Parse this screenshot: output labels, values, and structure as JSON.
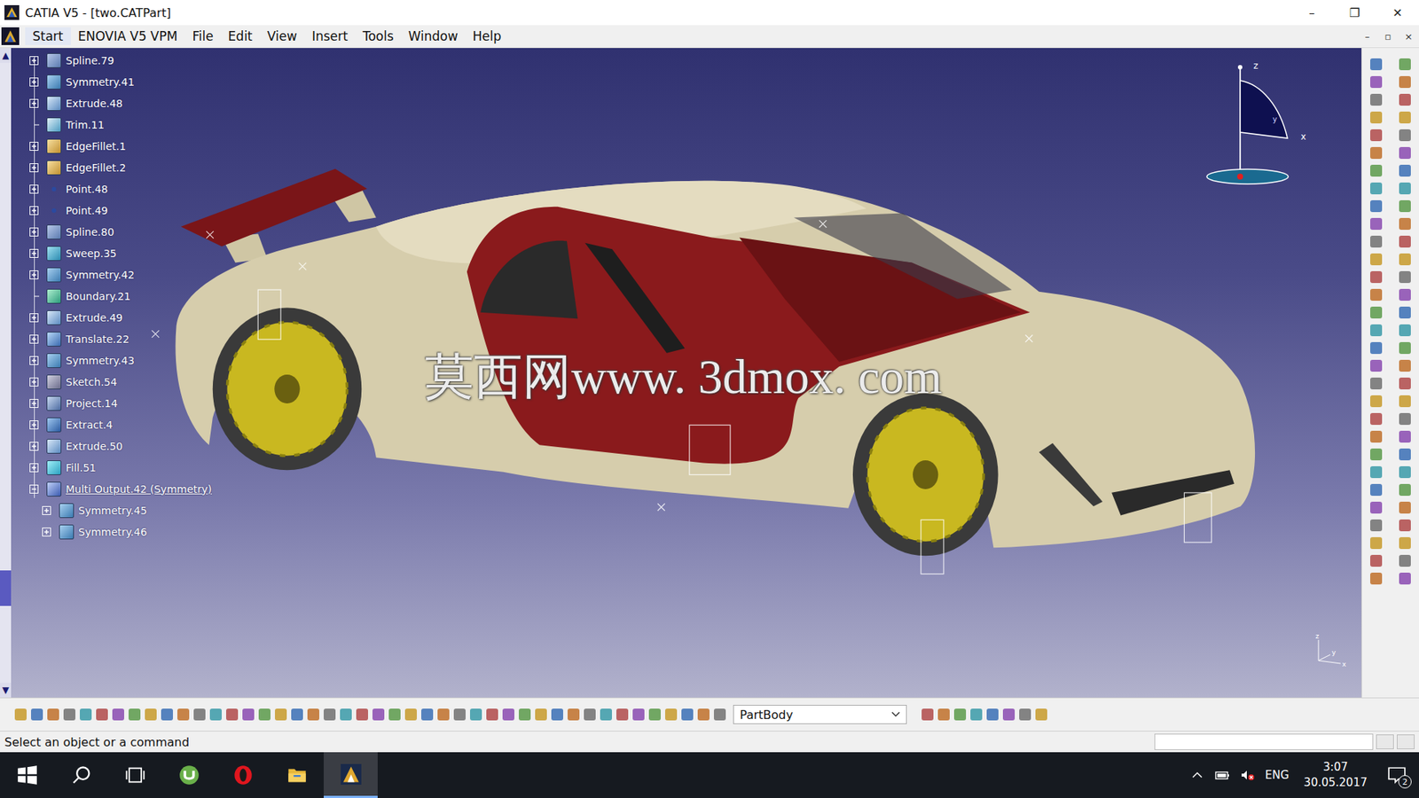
{
  "window": {
    "title": "CATIA V5 - [two.CATPart]",
    "controls": [
      "–",
      "❐",
      "✕"
    ]
  },
  "menu": {
    "items": [
      "Start",
      "ENOVIA V5 VPM",
      "File",
      "Edit",
      "View",
      "Insert",
      "Tools",
      "Window",
      "Help"
    ],
    "doc_controls": [
      "–",
      "▫",
      "×"
    ]
  },
  "scroll": {
    "up": "▲",
    "down": "▼",
    "level": 0.93
  },
  "tree": [
    {
      "label": "Spline.79",
      "kind": "spline",
      "expandable": true,
      "expanded": false,
      "current": false
    },
    {
      "label": "Symmetry.41",
      "kind": "symmetry",
      "expandable": true,
      "expanded": false,
      "current": false
    },
    {
      "label": "Extrude.48",
      "kind": "extrude",
      "expandable": true,
      "expanded": false,
      "current": false
    },
    {
      "label": "Trim.11",
      "kind": "trim",
      "expandable": false,
      "expanded": false,
      "current": false
    },
    {
      "label": "EdgeFillet.1",
      "kind": "fillet",
      "expandable": true,
      "expanded": false,
      "current": false
    },
    {
      "label": "EdgeFillet.2",
      "kind": "fillet",
      "expandable": true,
      "expanded": false,
      "current": false
    },
    {
      "label": "Point.48",
      "kind": "point",
      "expandable": true,
      "expanded": false,
      "current": false
    },
    {
      "label": "Point.49",
      "kind": "point",
      "expandable": true,
      "expanded": false,
      "current": false
    },
    {
      "label": "Spline.80",
      "kind": "spline",
      "expandable": true,
      "expanded": false,
      "current": false
    },
    {
      "label": "Sweep.35",
      "kind": "sweep",
      "expandable": true,
      "expanded": false,
      "current": false
    },
    {
      "label": "Symmetry.42",
      "kind": "symmetry",
      "expandable": true,
      "expanded": false,
      "current": false
    },
    {
      "label": "Boundary.21",
      "kind": "boundary",
      "expandable": false,
      "expanded": false,
      "current": false
    },
    {
      "label": "Extrude.49",
      "kind": "extrude",
      "expandable": true,
      "expanded": false,
      "current": false
    },
    {
      "label": "Translate.22",
      "kind": "translate",
      "expandable": true,
      "expanded": false,
      "current": false
    },
    {
      "label": "Symmetry.43",
      "kind": "symmetry",
      "expandable": true,
      "expanded": false,
      "current": false
    },
    {
      "label": "Sketch.54",
      "kind": "sketch",
      "expandable": true,
      "expanded": false,
      "current": false
    },
    {
      "label": "Project.14",
      "kind": "project",
      "expandable": true,
      "expanded": false,
      "current": false
    },
    {
      "label": "Extract.4",
      "kind": "extract",
      "expandable": true,
      "expanded": false,
      "current": false
    },
    {
      "label": "Extrude.50",
      "kind": "extrude",
      "expandable": true,
      "expanded": false,
      "current": false
    },
    {
      "label": "Fill.51",
      "kind": "fill",
      "expandable": true,
      "expanded": false,
      "current": false
    },
    {
      "label": "Multi Output.42 (Symmetry)",
      "kind": "multi",
      "expandable": true,
      "expanded": true,
      "current": true,
      "children": [
        {
          "label": "Symmetry.45",
          "kind": "symmetry",
          "expandable": true,
          "expanded": false,
          "current": false
        },
        {
          "label": "Symmetry.46",
          "kind": "symmetry",
          "expandable": true,
          "expanded": false,
          "current": false
        }
      ]
    }
  ],
  "compass": {
    "x": "x",
    "y": "y",
    "z": "z"
  },
  "axis": {
    "x": "x",
    "y": "y",
    "z": "z"
  },
  "watermark": "莫西网www. 3dmox. com",
  "part_selector": {
    "value": "PartBody"
  },
  "status_bar": {
    "message": "Select an object or a command",
    "input": ""
  },
  "taskbar": {
    "apps": [
      {
        "kind": "windows",
        "selected": false
      },
      {
        "kind": "search",
        "selected": false
      },
      {
        "kind": "taskview",
        "selected": false
      },
      {
        "kind": "utorrent",
        "selected": false
      },
      {
        "kind": "opera",
        "selected": false
      },
      {
        "kind": "explorer",
        "selected": false
      },
      {
        "kind": "catia",
        "selected": true
      }
    ],
    "language": "ENG",
    "time": "3:07",
    "date": "30.05.2017",
    "notifications": "2"
  }
}
